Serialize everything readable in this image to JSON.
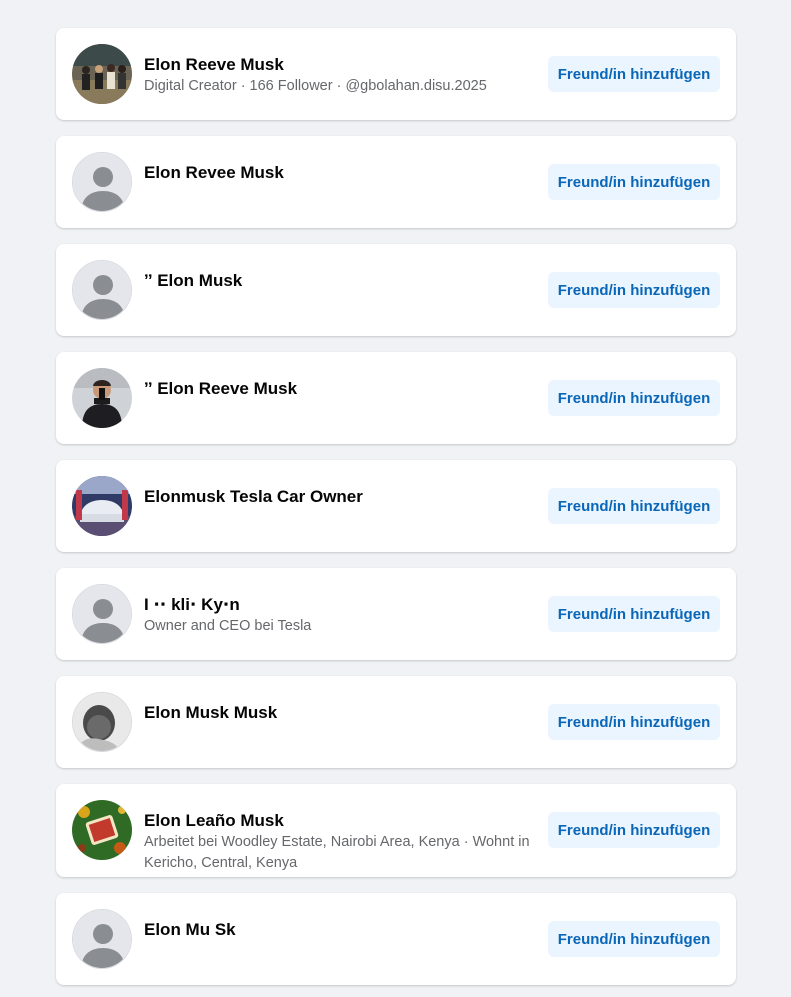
{
  "results": [
    {
      "name": "Elon Reeve Musk",
      "subtitle": "Digital Creator · 166 Follower · @gbolahan.disu.2025",
      "button": "Freund/in hinzufügen",
      "avatar": "photo-group"
    },
    {
      "name": "Elon Revee Musk",
      "subtitle": "",
      "button": "Freund/in hinzufügen",
      "avatar": "default"
    },
    {
      "name": "ˮ Elon Musk",
      "subtitle": "",
      "button": "Freund/in hinzufügen",
      "avatar": "default"
    },
    {
      "name": "ˮ Elon Reeve Musk",
      "subtitle": "",
      "button": "Freund/in hinzufügen",
      "avatar": "photo-man"
    },
    {
      "name": "Elonmusk Tesla Car Owner",
      "subtitle": "",
      "button": "Freund/in hinzufügen",
      "avatar": "photo-car"
    },
    {
      "name": "I ⋅⋅ kli⋅ Ky⋅n",
      "subtitle": "Owner and CEO bei Tesla",
      "button": "Freund/in hinzufügen",
      "avatar": "default"
    },
    {
      "name": "Elon Musk Musk",
      "subtitle": "",
      "button": "Freund/in hinzufügen",
      "avatar": "photo-face"
    },
    {
      "name": "Elon Leaño Musk",
      "subtitle": "Arbeitet bei Woodley Estate, Nairobi Area, Kenya · Wohnt in Kericho, Central, Kenya",
      "button": "Freund/in hinzufügen",
      "avatar": "photo-green"
    },
    {
      "name": "Elon Mu Sk",
      "subtitle": "",
      "button": "Freund/in hinzufügen",
      "avatar": "default"
    }
  ],
  "colors": {
    "page_background": "#f0f2f5",
    "card_background": "#ffffff",
    "button_background": "#ebf5ff",
    "button_text": "#0a66b7",
    "secondary_text": "#65676b"
  }
}
